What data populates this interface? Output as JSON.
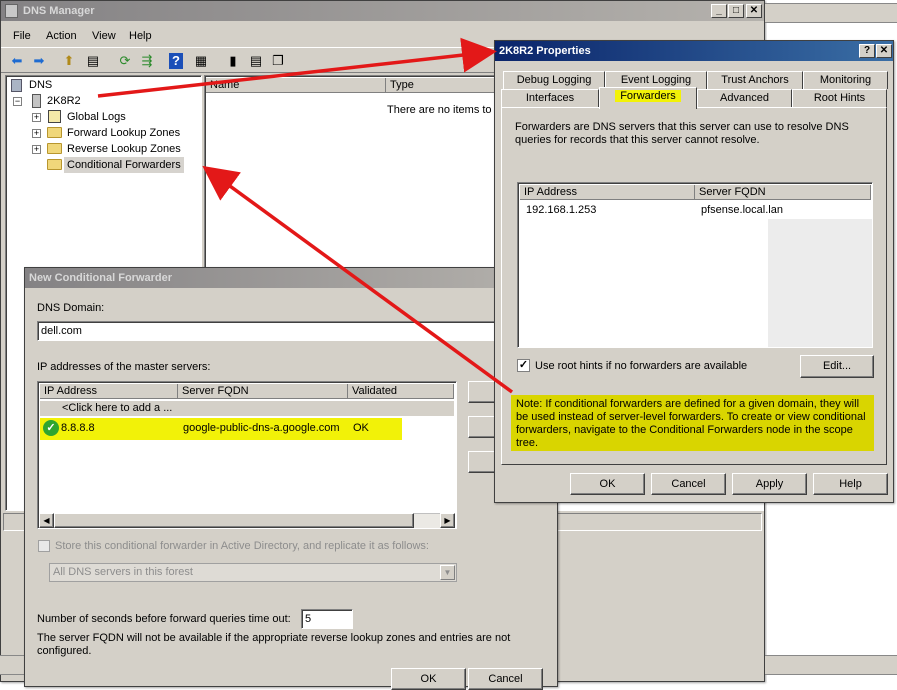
{
  "dns_manager": {
    "title": "DNS Manager",
    "menu": [
      "File",
      "Action",
      "View",
      "Help"
    ],
    "tree": {
      "root": "DNS",
      "server": "2K8R2",
      "children": [
        "Global Logs",
        "Forward Lookup Zones",
        "Reverse Lookup Zones",
        "Conditional Forwarders"
      ]
    },
    "list_headers": [
      "Name",
      "Type"
    ],
    "empty_message": "There are no items to"
  },
  "properties": {
    "title": "2K8R2 Properties",
    "tabs_row1": [
      "Debug Logging",
      "Event Logging",
      "Trust Anchors",
      "Monitoring"
    ],
    "tabs_row2": [
      "Interfaces",
      "Forwarders",
      "Advanced",
      "Root Hints"
    ],
    "active_tab": "Forwarders",
    "description": "Forwarders are DNS servers that this server can use to resolve DNS queries for records that this server cannot resolve.",
    "columns": [
      "IP Address",
      "Server FQDN"
    ],
    "rows": [
      {
        "ip": "192.168.1.253",
        "fqdn": "pfsense.local.lan"
      }
    ],
    "root_hints_label": "Use root hints if no forwarders are available",
    "root_hints_checked": true,
    "edit_button": "Edit...",
    "note": "Note: If conditional forwarders are defined for a given domain, they will be used instead of server-level forwarders.  To create or view conditional forwarders, navigate to the Conditional Forwarders node in the scope tree.",
    "buttons": [
      "OK",
      "Cancel",
      "Apply",
      "Help"
    ]
  },
  "ncf": {
    "title": "New Conditional Forwarder",
    "dns_domain_label": "DNS Domain:",
    "dns_domain_value": "dell.com",
    "master_servers_label": "IP addresses of the master servers:",
    "columns": [
      "IP Address",
      "Server FQDN",
      "Validated"
    ],
    "add_row": "<Click here to add a ...",
    "rows": [
      {
        "ip": "8.8.8.8",
        "fqdn": "google-public-dns-a.google.com",
        "validated": "OK"
      }
    ],
    "store_label": "Store this conditional forwarder in Active Directory, and replicate it as follows:",
    "replication_option": "All DNS servers in this forest",
    "timeout_label": "Number of seconds before forward queries time out:",
    "timeout_value": "5",
    "fqdn_note": "The server FQDN will not be available if the appropriate reverse lookup zones and entries are not configured.",
    "buttons": [
      "OK",
      "Cancel"
    ]
  },
  "colors": {
    "highlight": "#f2f208",
    "arrow": "#e31818",
    "active_title": "#0a246a"
  }
}
